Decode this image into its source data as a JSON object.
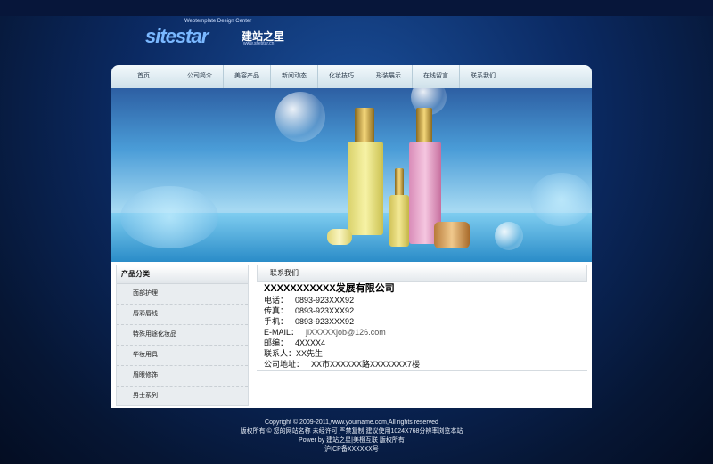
{
  "logo": {
    "tagline": "Webtemplate Design Center",
    "brand_a": "site",
    "brand_b": "star",
    "cn_name": "建站之星",
    "url": "www.sitestar.cn"
  },
  "nav": {
    "items": [
      "首页",
      "公司简介",
      "美容产品",
      "新闻动态",
      "化妆技巧",
      "形装展示",
      "在线留言",
      "联系我们"
    ]
  },
  "banner": {
    "bottle_labels": [
      "flowerage embryo",
      "flowerage embryo",
      "flowerage embryo"
    ],
    "slides_total": 7,
    "active_slide": 3
  },
  "sidebar": {
    "title": "产品分类",
    "categories": [
      "面部护理",
      "唇彩唇线",
      "特殊用途化妆品",
      "华妆用具",
      "眉眼修饰",
      "男士系列"
    ]
  },
  "contact": {
    "heading": "联系我们",
    "company": "XXXXXXXXXXX发展有限公司",
    "rows": [
      {
        "label": "电话：",
        "value": "0893-923XXX92"
      },
      {
        "label": "传真：",
        "value": "0893-923XXX92"
      },
      {
        "label": "手机：",
        "value": "0893-923XXX92"
      },
      {
        "label": "E-MAIL：",
        "value": "jiXXXXXjob@126.com"
      },
      {
        "label": "邮编：",
        "value": "4XXXX4"
      },
      {
        "label": "联系人：",
        "value": "XX先生"
      },
      {
        "label": "公司地址：",
        "value": "XX市XXXXXX路XXXXXXX7楼"
      }
    ]
  },
  "footer": {
    "line1": "Copyright © 2009-2011,www.yourname.com,All rights reserved",
    "line2": "版权所有 © 您的网站名称  未经许可  严禁复制  建议使用1024X768分辨率浏览本站",
    "line3": "Power by 建站之星|美橙互联 版权所有",
    "line4": "沪ICP备XXXXXX号"
  }
}
